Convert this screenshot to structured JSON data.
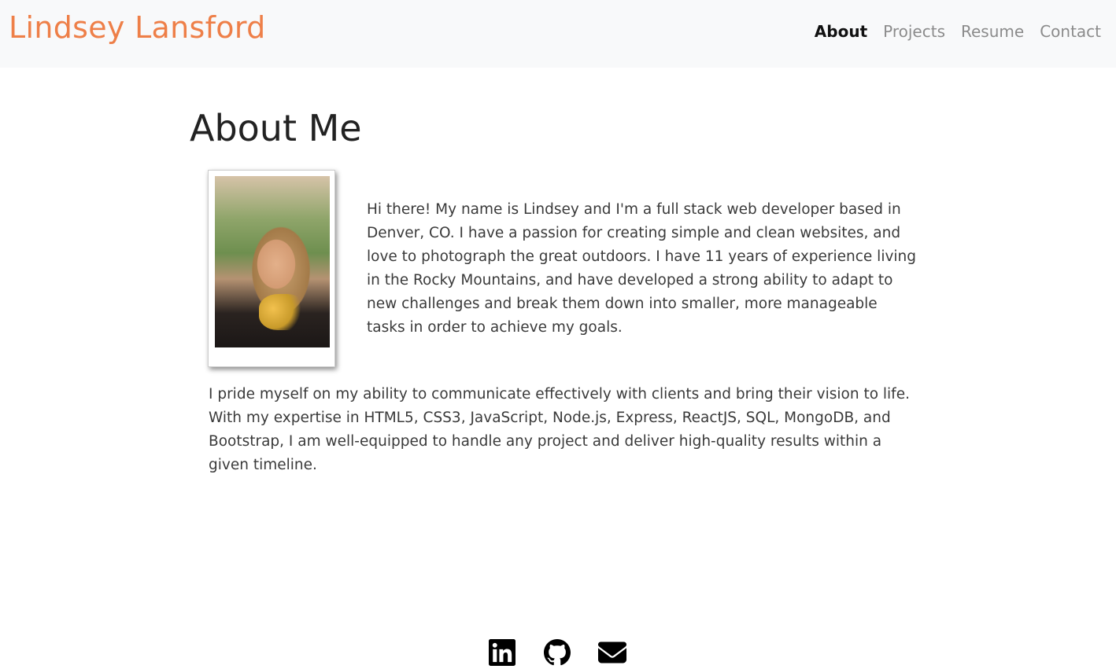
{
  "navbar": {
    "brand": "Lindsey Lansford",
    "links": [
      {
        "label": "About",
        "active": true
      },
      {
        "label": "Projects",
        "active": false
      },
      {
        "label": "Resume",
        "active": false
      },
      {
        "label": "Contact",
        "active": false
      }
    ]
  },
  "main": {
    "title": "About Me",
    "paragraphs": [
      "Hi there! My name is Lindsey and I'm a full stack web developer based in Denver, CO. I have a passion for creating simple and clean websites, and love to photograph the great outdoors. I have 11 years of experience living in the Rocky Mountains, and have developed a strong ability to adapt to new challenges and break them down into smaller, more manageable tasks in order to achieve my goals.",
      "I pride myself on my ability to communicate effectively with clients and bring their vision to life. With my expertise in HTML5, CSS3, JavaScript, Node.js, Express, ReactJS, SQL, MongoDB, and Bootstrap, I am well-equipped to handle any project and deliver high-quality results within a given timeline."
    ]
  },
  "footer": {
    "icons": [
      "linkedin-icon",
      "github-icon",
      "email-icon"
    ]
  },
  "colors": {
    "brand": "#ee7f48",
    "navbar_bg": "#f8f9fa",
    "nav_active": "#111111",
    "nav_inactive": "#8b8b8b"
  }
}
